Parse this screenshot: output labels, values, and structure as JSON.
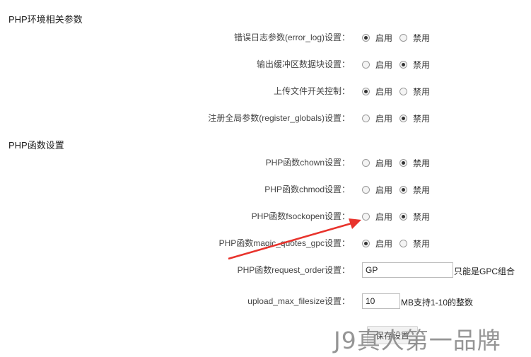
{
  "sections": {
    "env_title": "PHP环境相关参数",
    "func_title": "PHP函数设置"
  },
  "radio_options": {
    "enable": "启用",
    "disable": "禁用"
  },
  "rows": {
    "error_log": {
      "label": "错误日志参数(error_log)设置：",
      "value": "enable"
    },
    "output_buffering": {
      "label": "输出缓冲区数据块设置：",
      "value": "disable"
    },
    "file_uploads": {
      "label": "上传文件开关控制：",
      "value": "enable"
    },
    "register_globals": {
      "label": "注册全局参数(register_globals)设置：",
      "value": "disable"
    },
    "chown": {
      "label": "PHP函数chown设置：",
      "value": "disable"
    },
    "chmod": {
      "label": "PHP函数chmod设置：",
      "value": "disable"
    },
    "fsockopen": {
      "label": "PHP函数fsockopen设置：",
      "value": "disable"
    },
    "magic_quotes_gpc": {
      "label": "PHP函数magic_quotes_gpc设置：",
      "value": "enable"
    }
  },
  "inputs": {
    "request_order": {
      "label": "PHP函数request_order设置：",
      "value": "GP",
      "hint": "只能是GPC组合"
    },
    "upload_max_filesize": {
      "label": "upload_max_filesize设置：",
      "value": "10",
      "hint": "MB支持1-10的整数"
    }
  },
  "save_button": "保存设置",
  "watermark": "J9真人第一品牌",
  "colors": {
    "annotation_arrow": "#e8332c"
  }
}
